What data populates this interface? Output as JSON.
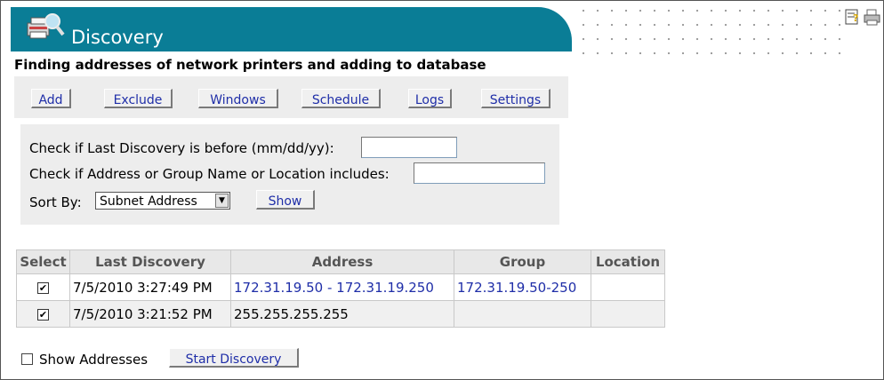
{
  "header": {
    "title": "Discovery"
  },
  "subtitle": "Finding addresses of network printers and adding to database",
  "toolbar": {
    "buttons": [
      "Add",
      "Exclude",
      "Windows",
      "Schedule",
      "Logs",
      "Settings"
    ]
  },
  "filter": {
    "last_discovery_label": "Check if Last Discovery is before (mm/dd/yy):",
    "last_discovery_value": "",
    "address_label": "Check if Address or Group Name or Location includes:",
    "address_value": "",
    "sort_label": "Sort By:",
    "sort_value": "Subnet Address",
    "show_button": "Show"
  },
  "table": {
    "headers": [
      "Select",
      "Last Discovery",
      "Address",
      "Group",
      "Location"
    ],
    "rows": [
      {
        "selected": true,
        "last_discovery": "7/5/2010 3:27:49 PM",
        "address": "172.31.19.50 - 172.31.19.250",
        "group": "172.31.19.50-250",
        "location": ""
      },
      {
        "selected": true,
        "last_discovery": "7/5/2010 3:21:52 PM",
        "address": "255.255.255.255",
        "group": "",
        "location": ""
      }
    ]
  },
  "footer": {
    "show_addresses_label": "Show Addresses",
    "show_addresses_checked": false,
    "start_button": "Start Discovery"
  },
  "icons": {
    "help": "help-notes-icon",
    "print": "printer-icon"
  },
  "colors": {
    "header_bg": "#0a7d96",
    "link": "#1f2ea8"
  }
}
